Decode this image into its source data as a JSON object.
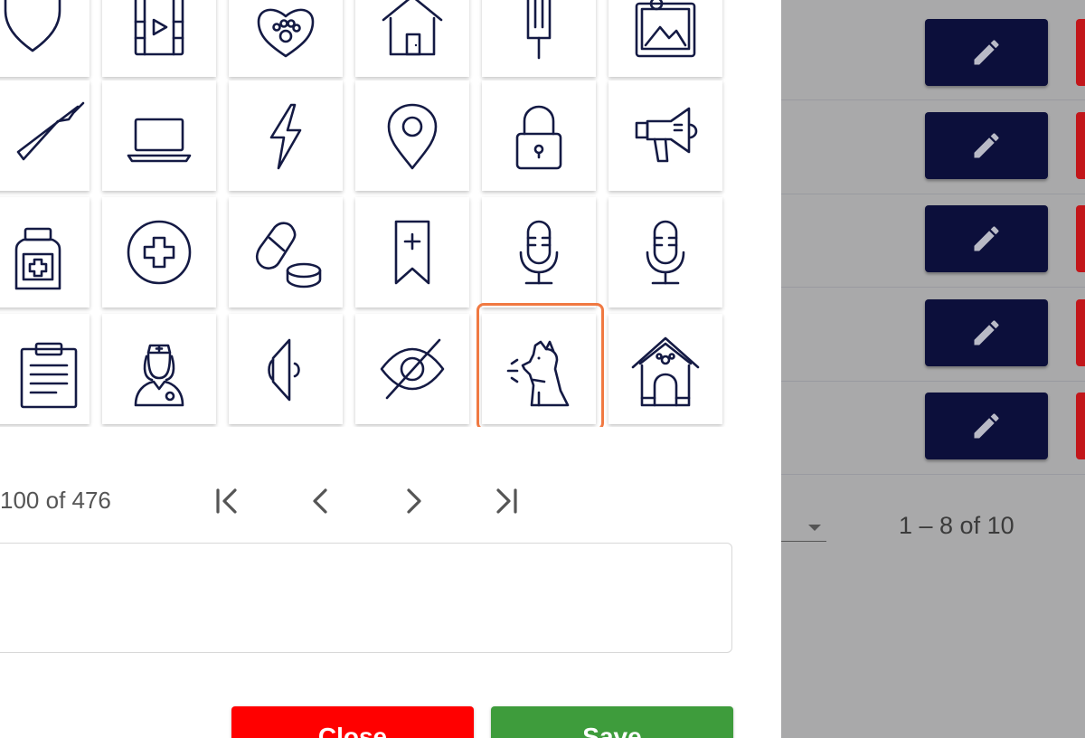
{
  "dialog": {
    "icons": [
      [
        "heart-shield-icon",
        "film-play-icon",
        "paw-heart-icon",
        "house-icon",
        "fork-icon",
        "image-landscape-icon"
      ],
      [
        "knife-icon",
        "laptop-icon",
        "lightning-icon",
        "location-pin-icon",
        "padlock-icon",
        "megaphone-icon"
      ],
      [
        "medicine-bottle-icon",
        "medical-cross-icon",
        "pills-icon",
        "bookmark-add-icon",
        "microphone-icon",
        "microphone-icon"
      ],
      [
        "clipboard-icon",
        "nurse-icon",
        "speaker-icon",
        "eye-off-icon",
        "barking-dog-icon",
        "dog-house-icon"
      ]
    ],
    "selected_icon": "barking-dog-icon",
    "highlight_color": "#f07942",
    "paginator": {
      "range_label": "100 of 476",
      "first_icon": "first-page-icon",
      "prev_icon": "chevron-left-icon",
      "next_icon": "chevron-right-icon",
      "last_icon": "last-page-icon"
    },
    "text_field": {
      "value": "",
      "placeholder": ""
    },
    "close_label": "Close",
    "save_label": "Save",
    "close_color": "#ff0000",
    "save_color": "#3e9c3c"
  },
  "background": {
    "edit_icon": "pencil-icon",
    "edit_button_color": "#0c0f3b",
    "delete_button_color": "#c2161a",
    "paginator_range": "1 – 8 of 10"
  }
}
